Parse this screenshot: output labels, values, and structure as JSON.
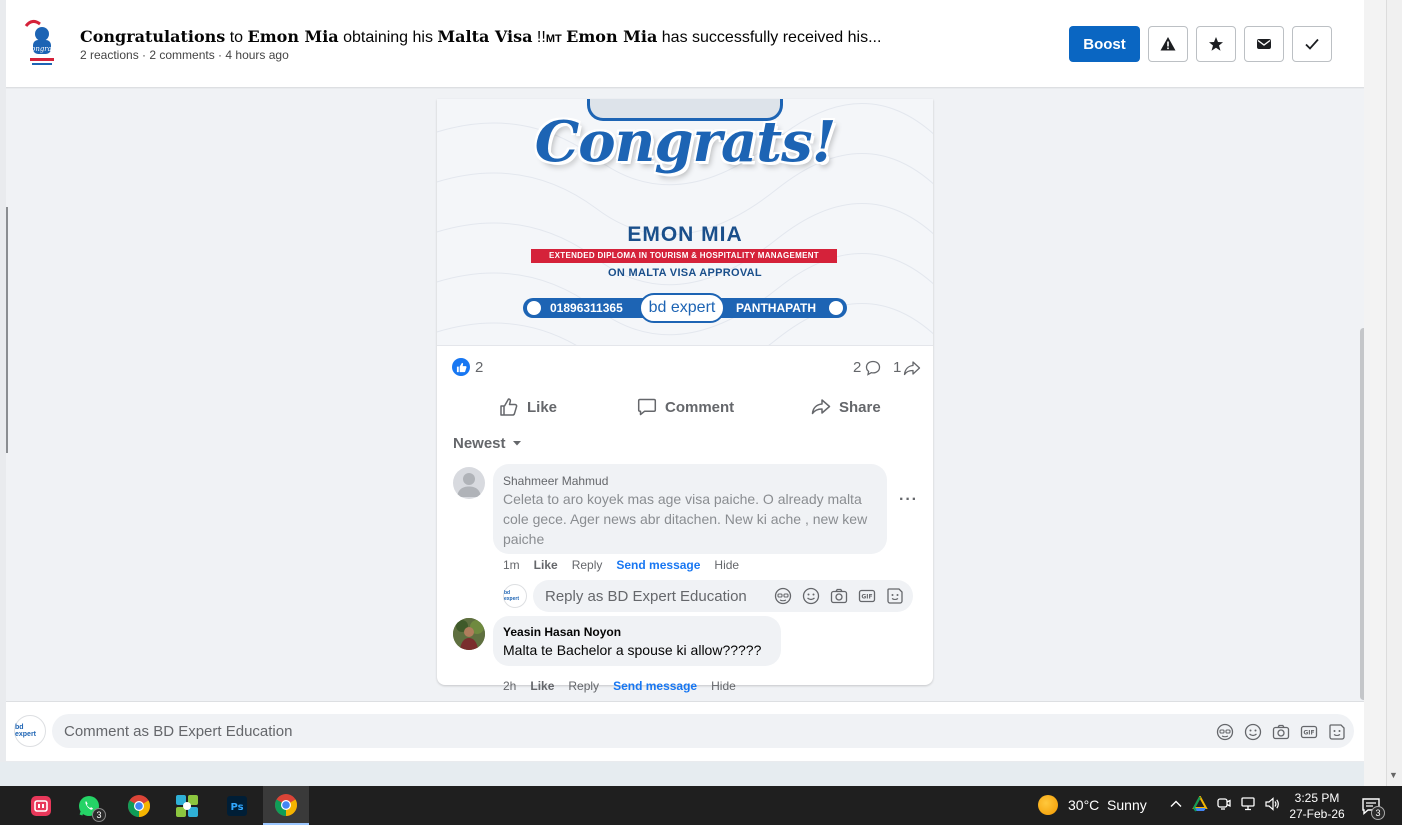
{
  "header": {
    "title_parts": {
      "p1": "Congratulations",
      "p2": " to ",
      "p3": "Emon Mia",
      "p4": " obtaining his ",
      "p5": "Malta Visa",
      "p6": " !!",
      "p7": "MT",
      "p8": " ",
      "p9": "Emon Mia",
      "p10": " has successfully received his..."
    },
    "meta": "2 reactions · 2 comments · 4 hours ago",
    "boost_label": "Boost",
    "icons": [
      "warning-icon",
      "star-icon",
      "mail-icon",
      "check-icon"
    ]
  },
  "post": {
    "image": {
      "headline": "Congrats!",
      "name": "EMON MIA",
      "program": "EXTENDED DIPLOMA IN TOURISM & HOSPITALITY MANAGEMENT",
      "approval": "ON MALTA VISA APPROVAL",
      "phone": "01896311365",
      "brand": "bd expert",
      "location": "PANTHAPATH"
    },
    "reactions": "2",
    "comments_count": "2",
    "shares_count": "1",
    "actions": {
      "like": "Like",
      "comment": "Comment",
      "share": "Share"
    },
    "sort_label": "Newest"
  },
  "comments": [
    {
      "author": "Shahmeer Mahmud",
      "text": "Celeta to aro koyek mas age visa paiche. O already malta cole gece. Ager news abr ditachen. New ki ache , new kew paiche",
      "time": "1m",
      "actions": [
        "Like",
        "Reply",
        "Send message",
        "Hide"
      ]
    },
    {
      "author": "Yeasin Hasan Noyon",
      "text": "Malta te Bachelor a spouse ki allow?????",
      "time": "2h",
      "actions": [
        "Like",
        "Reply",
        "Send message",
        "Hide"
      ]
    }
  ],
  "reply_box": {
    "placeholder": "Reply as BD Expert Education",
    "avatar_text": "bd expert"
  },
  "comment_bar": {
    "placeholder": "Comment as BD Expert Education",
    "avatar_text": "bd expert"
  },
  "taskbar": {
    "whatsapp_badge": "3",
    "weather": "30°C  Sunny",
    "time": "3:25 PM",
    "date": "27-Feb-26",
    "notify_badge": "3"
  },
  "colors": {
    "accent": "#0a66c2",
    "link": "#1877f2",
    "brand_blue": "#1d64b4",
    "ribbon_red": "#d5223a"
  }
}
